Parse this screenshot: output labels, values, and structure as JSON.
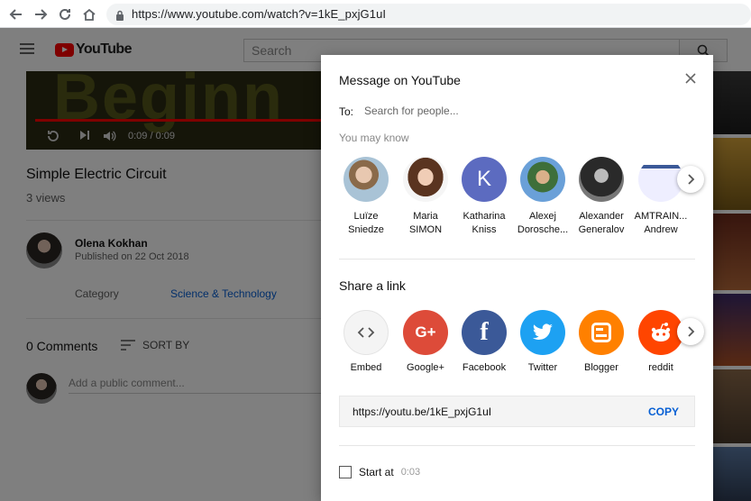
{
  "browser": {
    "url": "https://www.youtube.com/watch?v=1kE_pxjG1uI"
  },
  "youtube": {
    "logo_text": "YouTube",
    "search_placeholder": "Search",
    "video": {
      "overlay_text": "Beginn",
      "time": "0:09 / 0:09",
      "title": "Simple Electric Circuit",
      "views": "3 views"
    },
    "channel": {
      "name": "Olena Kokhan",
      "published": "Published on 22 Oct 2018"
    },
    "category_label": "Category",
    "category_value": "Science & Technology",
    "comments_count": "0 Comments",
    "sort_label": "SORT BY",
    "add_comment_placeholder": "Add a public comment..."
  },
  "dialog": {
    "title": "Message on YouTube",
    "to_label": "To:",
    "to_placeholder": "Search for people...",
    "you_may_know": "You may know",
    "people": [
      {
        "name": "Luïze\nSniedze"
      },
      {
        "name": "Maria\nSIMON"
      },
      {
        "name": "Katharina\nKniss",
        "initial": "K"
      },
      {
        "name": "Alexej\nDorosche..."
      },
      {
        "name": "Alexander\nGeneralov"
      },
      {
        "name": "AMTRAIN...\nAndrew"
      }
    ],
    "share_link_title": "Share a link",
    "apps": [
      {
        "label": "Embed",
        "color": "#f4f4f4"
      },
      {
        "label": "Google+",
        "color": "#dd4b39"
      },
      {
        "label": "Facebook",
        "color": "#3b5998"
      },
      {
        "label": "Twitter",
        "color": "#1da1f2"
      },
      {
        "label": "Blogger",
        "color": "#ff8000"
      },
      {
        "label": "reddit",
        "color": "#ff4500"
      }
    ],
    "link": "https://youtu.be/1kE_pxjG1uI",
    "copy_label": "COPY",
    "start_at_label": "Start at",
    "start_at_time": "0:03"
  }
}
